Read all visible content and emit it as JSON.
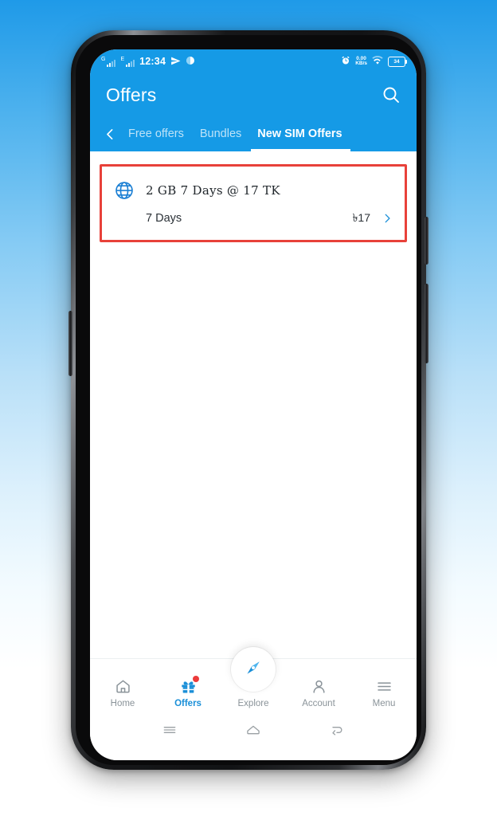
{
  "status_bar": {
    "network_1": "G",
    "network_2": "E",
    "time": "12:34",
    "telegram_icon": "send-icon",
    "weather_icon": "moon-icon",
    "alarm_icon": "alarm-clock-icon",
    "data_rate_value": "0.00",
    "data_rate_unit": "KB/s",
    "wifi_icon": "wifi-icon",
    "battery_level": "34"
  },
  "header": {
    "title": "Offers",
    "search_icon": "search-icon",
    "back_icon": "chevron-left-icon"
  },
  "tabs": [
    {
      "label": "Free offers",
      "active": false
    },
    {
      "label": "Bundles",
      "active": false
    },
    {
      "label": "New SIM Offers",
      "active": true
    }
  ],
  "offer_card": {
    "icon": "globe-icon",
    "title": "2 GB 7 Days @ 17 TK",
    "validity": "7 Days",
    "price": "৳17",
    "chevron_icon": "chevron-right-icon",
    "highlight_color": "#e8413a"
  },
  "bottom_nav": {
    "items": [
      {
        "label": "Home",
        "icon": "home-icon",
        "active": false,
        "badge": false
      },
      {
        "label": "Offers",
        "icon": "gift-icon",
        "active": true,
        "badge": true
      },
      {
        "label": "Explore",
        "icon": "compass-icon",
        "active": false,
        "badge": false
      },
      {
        "label": "Account",
        "icon": "person-icon",
        "active": false,
        "badge": false
      },
      {
        "label": "Menu",
        "icon": "hamburger-icon",
        "active": false,
        "badge": false
      }
    ]
  },
  "system_nav": {
    "recents_icon": "recents-icon",
    "home_icon": "home-outline-icon",
    "back_icon": "back-arrow-icon"
  },
  "colors": {
    "brand_blue": "#159ae6",
    "accent_blue": "#1a8fd8",
    "badge_red": "#ec3b3b",
    "highlight_red": "#e8413a"
  }
}
